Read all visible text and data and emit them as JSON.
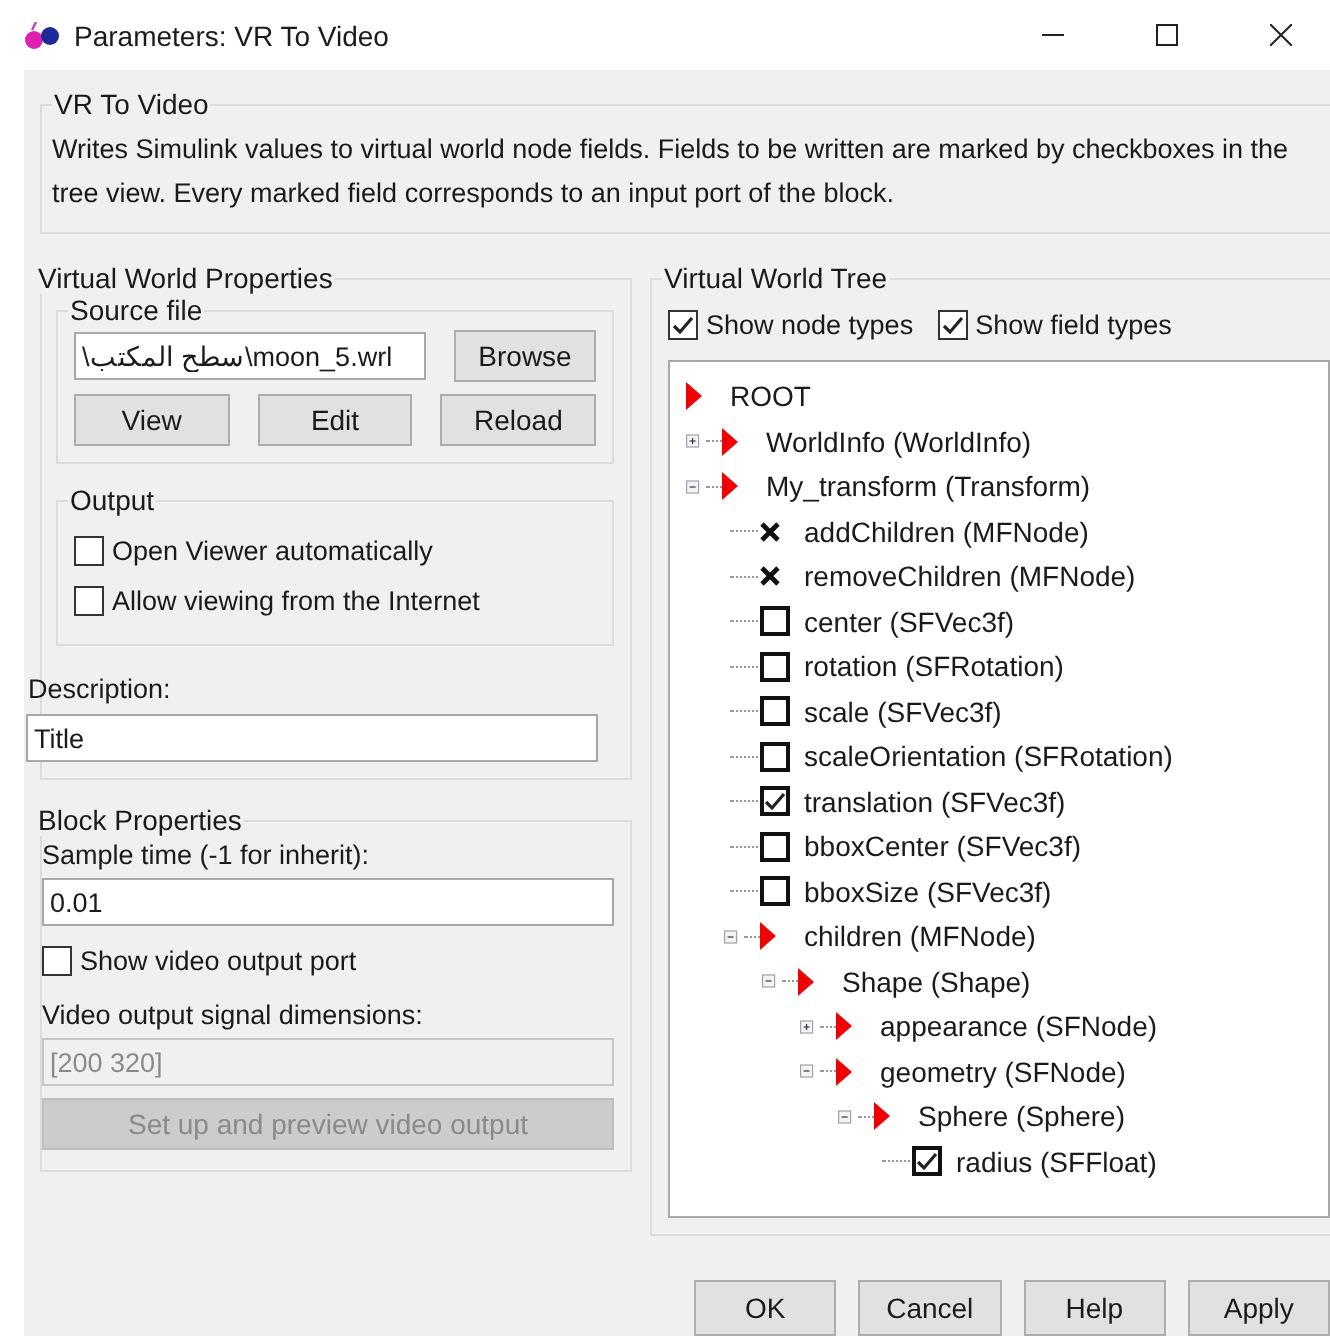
{
  "window": {
    "title": "Parameters: VR To Video"
  },
  "block": {
    "title": "VR To Video",
    "description": "Writes Simulink values to virtual world node fields. Fields to be written are marked by checkboxes in the tree view. Every marked field corresponds to an input port of the block."
  },
  "virtual_world_properties": {
    "title": "Virtual World Properties",
    "source_file": {
      "title": "Source file",
      "value": "\\سطح المكتب\\moon_5.wrl",
      "browse": "Browse",
      "buttons": [
        "View",
        "Edit",
        "Reload"
      ]
    },
    "output": {
      "title": "Output",
      "options": [
        {
          "label": "Open Viewer automatically",
          "checked": false
        },
        {
          "label": "Allow viewing from the Internet",
          "checked": false
        }
      ]
    },
    "description": {
      "label": "Description:",
      "value": "Title"
    }
  },
  "block_properties": {
    "title": "Block Properties",
    "sample_time": {
      "label": "Sample time (-1 for inherit):",
      "value": "0.01"
    },
    "show_port": {
      "label": "Show video output port",
      "checked": false
    },
    "dimensions": {
      "label": "Video output signal dimensions:",
      "value": "[200 320]",
      "disabled": true
    },
    "setup_button": {
      "label": "Set up and preview video output",
      "disabled": true
    }
  },
  "virtual_world_tree": {
    "title": "Virtual World Tree",
    "options": [
      {
        "label": "Show node types",
        "checked": true
      },
      {
        "label": "Show field types",
        "checked": true
      }
    ],
    "tree": [
      {
        "kind": "root",
        "label": "ROOT",
        "children": [
          {
            "kind": "node",
            "label": "WorldInfo (WorldInfo)",
            "expanded": false
          },
          {
            "kind": "node",
            "label": "My_transform (Transform)",
            "expanded": true,
            "children": [
              {
                "kind": "readonly",
                "label": "addChildren (MFNode)"
              },
              {
                "kind": "readonly",
                "label": "removeChildren (MFNode)"
              },
              {
                "kind": "field",
                "label": "center (SFVec3f)",
                "checked": false
              },
              {
                "kind": "field",
                "label": "rotation (SFRotation)",
                "checked": false
              },
              {
                "kind": "field",
                "label": "scale (SFVec3f)",
                "checked": false
              },
              {
                "kind": "field",
                "label": "scaleOrientation (SFRotation)",
                "checked": false
              },
              {
                "kind": "field",
                "label": "translation (SFVec3f)",
                "checked": true
              },
              {
                "kind": "field",
                "label": "bboxCenter (SFVec3f)",
                "checked": false
              },
              {
                "kind": "field",
                "label": "bboxSize (SFVec3f)",
                "checked": false
              },
              {
                "kind": "node",
                "label": "children (MFNode)",
                "expanded": true,
                "children": [
                  {
                    "kind": "node",
                    "label": "Shape (Shape)",
                    "expanded": true,
                    "children": [
                      {
                        "kind": "node",
                        "label": "appearance (SFNode)",
                        "expanded": false
                      },
                      {
                        "kind": "node",
                        "label": "geometry (SFNode)",
                        "expanded": true,
                        "children": [
                          {
                            "kind": "node",
                            "label": "Sphere (Sphere)",
                            "expanded": true,
                            "children": [
                              {
                                "kind": "field",
                                "label": "radius (SFFloat)",
                                "checked": true
                              }
                            ]
                          }
                        ]
                      }
                    ]
                  }
                ]
              }
            ]
          }
        ]
      }
    ]
  },
  "buttons": [
    "OK",
    "Cancel",
    "Help",
    "Apply"
  ]
}
